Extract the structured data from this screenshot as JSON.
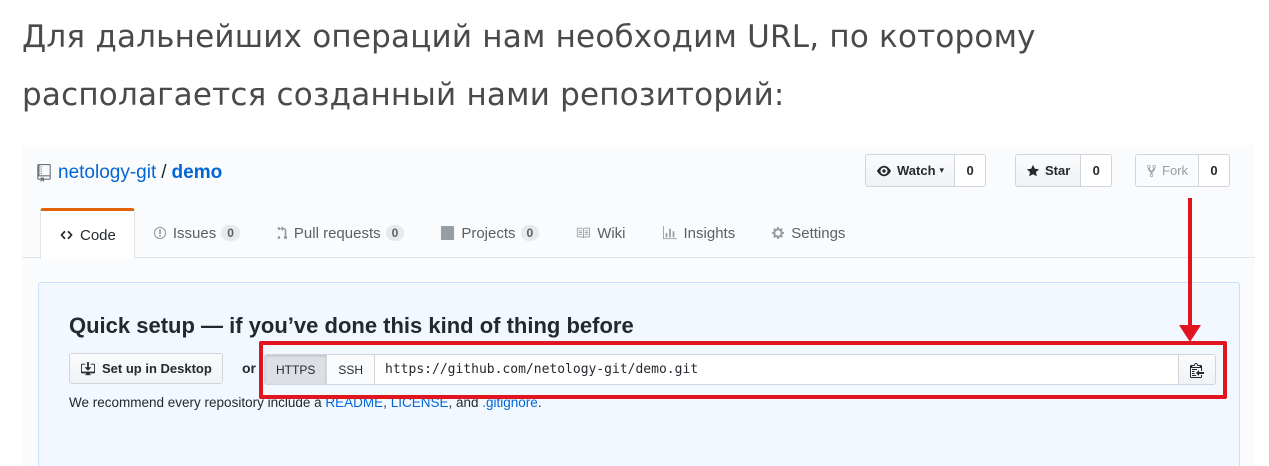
{
  "intro_text": "Для дальнейших операций нам необходим URL, по которому располагается созданный нами репозиторий:",
  "repo": {
    "owner": "netology-git",
    "separator": "/",
    "name": "demo"
  },
  "actions": {
    "watch_label": "Watch",
    "watch_count": "0",
    "star_label": "Star",
    "star_count": "0",
    "fork_label": "Fork",
    "fork_count": "0"
  },
  "tabs": [
    {
      "label": "Code",
      "icon": "code-icon"
    },
    {
      "label": "Issues",
      "count": "0",
      "icon": "issue-icon"
    },
    {
      "label": "Pull requests",
      "count": "0",
      "icon": "pull-request-icon"
    },
    {
      "label": "Projects",
      "count": "0",
      "icon": "project-icon"
    },
    {
      "label": "Wiki",
      "icon": "book-icon"
    },
    {
      "label": "Insights",
      "icon": "graph-icon"
    },
    {
      "label": "Settings",
      "icon": "gear-icon"
    }
  ],
  "quick_setup": {
    "title": "Quick setup — if you’ve done this kind of thing before",
    "desktop_button": "Set up in Desktop",
    "or": "or",
    "https_label": "HTTPS",
    "ssh_label": "SSH",
    "clone_url": "https://github.com/netology-git/demo.git",
    "recommend_prefix": "We recommend every repository include a",
    "readme": "README",
    "sep1": ",",
    "license": "LICENSE",
    "and": ", and",
    "gitignore": ".gitignore",
    "end": "."
  },
  "colors": {
    "accent": "#0366d6",
    "annotation_red": "#e11520",
    "tab_selected_border": "#e36209"
  }
}
